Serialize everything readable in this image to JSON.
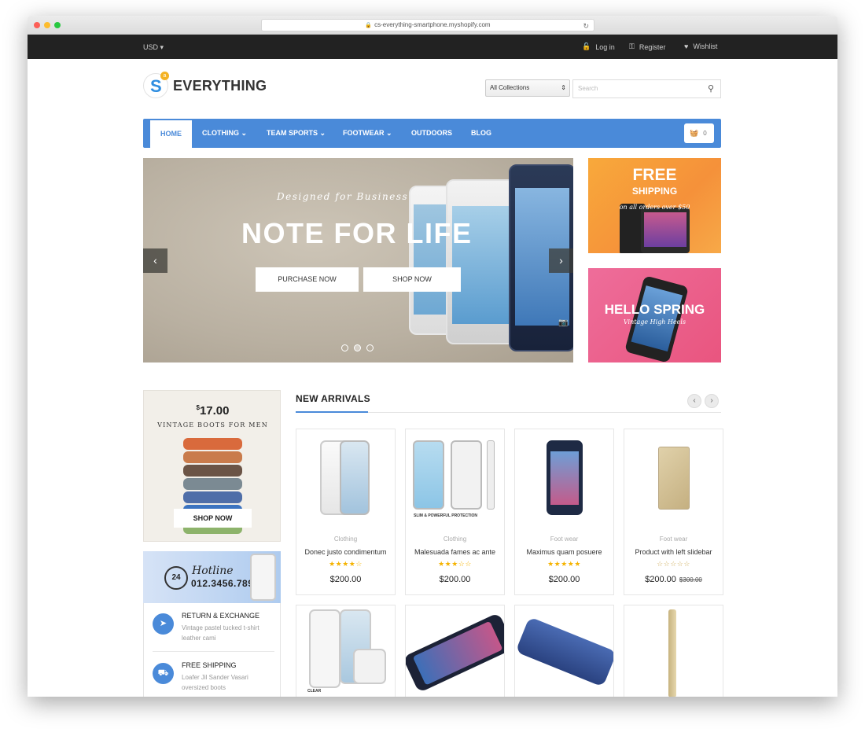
{
  "browser": {
    "url": "cs-everything-smartphone.myshopify.com"
  },
  "topbar": {
    "currency": "USD",
    "login": "Log in",
    "register": "Register",
    "wishlist": "Wishlist"
  },
  "header": {
    "logo_text": "EVERYTHING",
    "logo_letter": "S",
    "collections_select": "All Collections",
    "search_placeholder": "Search"
  },
  "nav": {
    "items": [
      "HOME",
      "CLOTHING",
      "TEAM SPORTS",
      "FOOTWEAR",
      "OUTDOORS",
      "BLOG"
    ],
    "cart_count": "0"
  },
  "slider": {
    "subtitle": "Designed for Business",
    "headline": "NOTE FOR LIFE",
    "btn_purchase": "PURCHASE NOW",
    "btn_shop": "SHOP NOW"
  },
  "banners": {
    "free_title": "FREE",
    "free_sub": "SHIPPING",
    "free_note": "on all orders over $50",
    "spring_title": "HELLO SPRING",
    "spring_sub": "Vintage High Heels"
  },
  "promo": {
    "price_symbol": "$",
    "price": "17.00",
    "caption": "VINTAGE BOOTS FOR MEN",
    "button": "SHOP NOW"
  },
  "hotline": {
    "badge": "24",
    "label": "Hotline",
    "number": "012.3456.7899"
  },
  "services": [
    {
      "title": "RETURN & EXCHANGE",
      "desc": "Vintage pastel tucked t-shirt leather cami",
      "icon": "paper-plane-icon"
    },
    {
      "title": "FREE SHIPPING",
      "desc": "Loafer Jil Sander Vasari oversized boots",
      "icon": "truck-icon"
    }
  ],
  "new_arrivals": {
    "title": "NEW ARRIVALS",
    "products": [
      {
        "category": "Clothing",
        "name": "Donec justo condimentum",
        "stars": "★★★★☆",
        "price": "$200.00",
        "old_price": ""
      },
      {
        "category": "Clothing",
        "name": "Malesuada fames ac ante",
        "stars": "★★★☆☆",
        "price": "$200.00",
        "old_price": ""
      },
      {
        "category": "Foot wear",
        "name": "Maximus quam posuere",
        "stars": "★★★★★",
        "price": "$200.00",
        "old_price": ""
      },
      {
        "category": "Foot wear",
        "name": "Product with left slidebar",
        "stars": "☆☆☆☆☆",
        "price": "$200.00",
        "old_price": "$300.00"
      }
    ],
    "product1_caption": "SLIM & POWERFUL PROTECTION",
    "row2_caption": "CLEAR"
  },
  "colors": {
    "accent": "#4a8ad9",
    "topbar": "#222222",
    "star": "#f5b301",
    "orange_banner": "#f5913a",
    "pink_banner": "#e9557f"
  }
}
